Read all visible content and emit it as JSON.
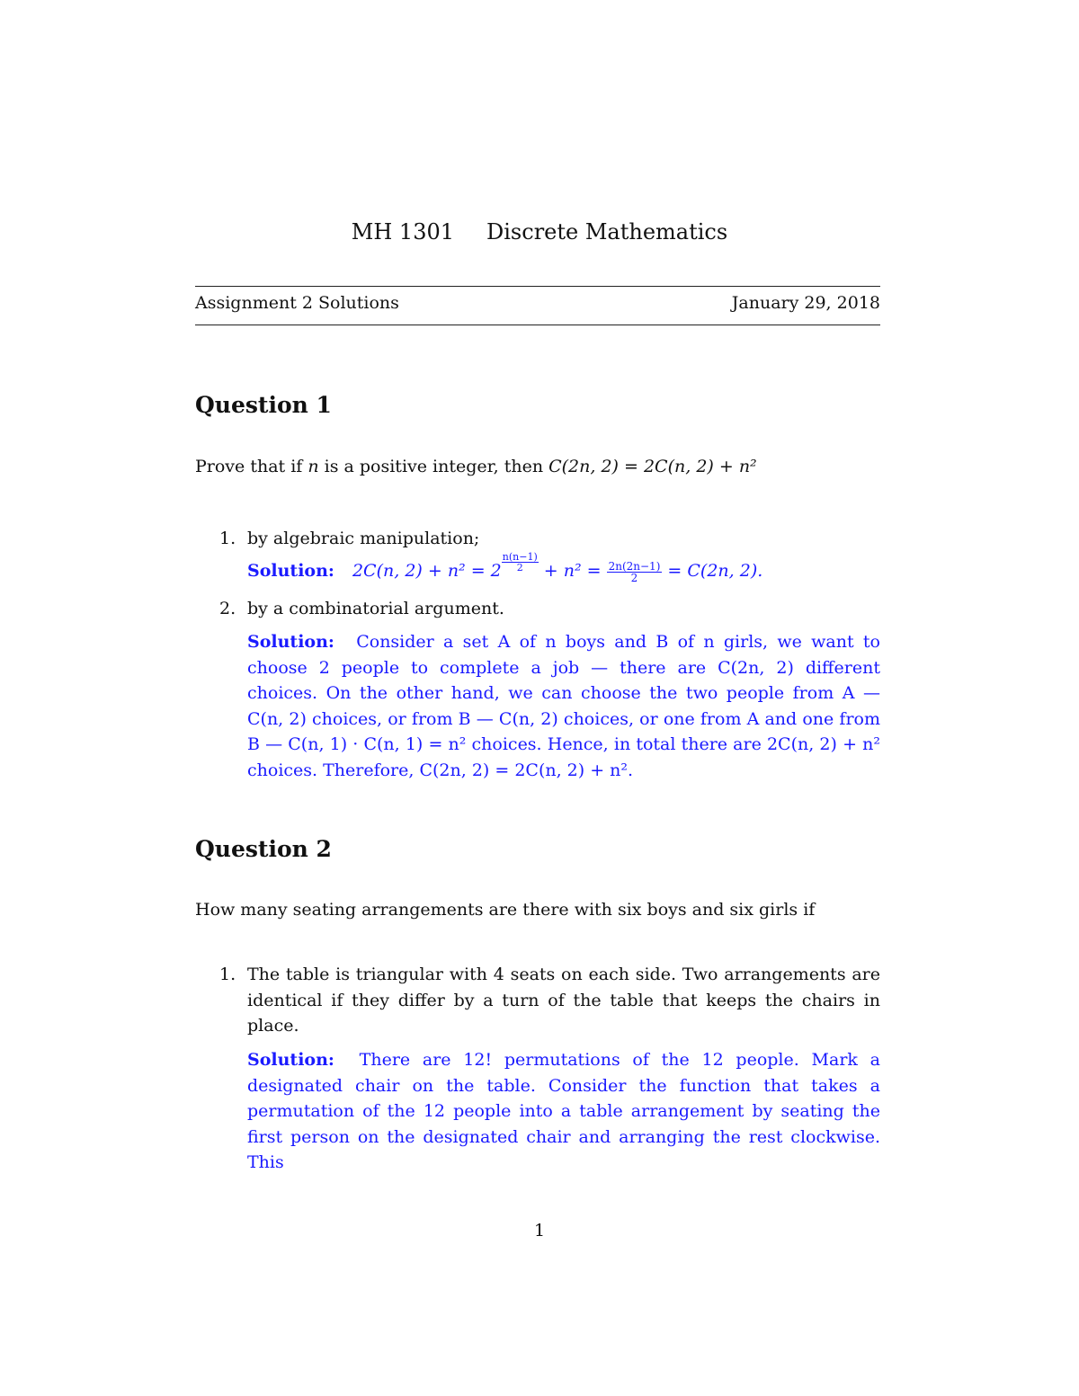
{
  "header": {
    "course_code": "MH 1301",
    "course_title": "Discrete Mathematics",
    "doc_title": "Assignment 2 Solutions",
    "date": "January 29, 2018"
  },
  "question1": {
    "title": "Question 1",
    "prompt": "Prove that if n is a positive integer, then C(2n, 2) = 2C(n, 2) + n²",
    "prompt_parts": {
      "before": "Prove that if ",
      "var": "n",
      "middle": " is a positive integer, then ",
      "formula": "C(2n, 2) = 2C(n, 2) + n²"
    },
    "items": [
      {
        "number": "1.",
        "text": "by algebraic manipulation;",
        "solution_label": "Solution:",
        "solution": {
          "lhs": "2C(n, 2) + n² = 2",
          "exp_num": "n(n−1)",
          "exp_den": "2",
          "mid": " + n² = ",
          "frac_num": "2n(2n−1)",
          "frac_den": "2",
          "rhs": " = C(2n, 2)."
        }
      },
      {
        "number": "2.",
        "text": "by a combinatorial argument.",
        "solution_label": "Solution:",
        "solution_text": "Consider a set A of n boys and B of n girls, we want to choose 2 people to complete a job — there are C(2n, 2) different choices. On the other hand, we can choose the two people from A — C(n, 2) choices, or from B — C(n, 2) choices, or one from A and one from B — C(n, 1) · C(n, 1) = n² choices. Hence, in total there are 2C(n, 2) + n² choices. Therefore, C(2n, 2) = 2C(n, 2) + n²."
      }
    ]
  },
  "question2": {
    "title": "Question 2",
    "prompt": "How many seating arrangements are there with six boys and six girls if",
    "items": [
      {
        "number": "1.",
        "text": "The table is triangular with 4 seats on each side. Two arrangements are identical if they differ by a turn of the table that keeps the chairs in place.",
        "solution_label": "Solution:",
        "solution_text": "There are 12! permutations of the 12 people. Mark a designated chair on the table. Consider the function that takes a permutation of the 12 people into a table arrangement by seating the first person on the designated chair and arranging the rest clockwise. This"
      }
    ]
  },
  "footer": {
    "page_number": "1"
  },
  "colors": {
    "solution_text": "#1a1aff",
    "body_text": "#111111"
  }
}
